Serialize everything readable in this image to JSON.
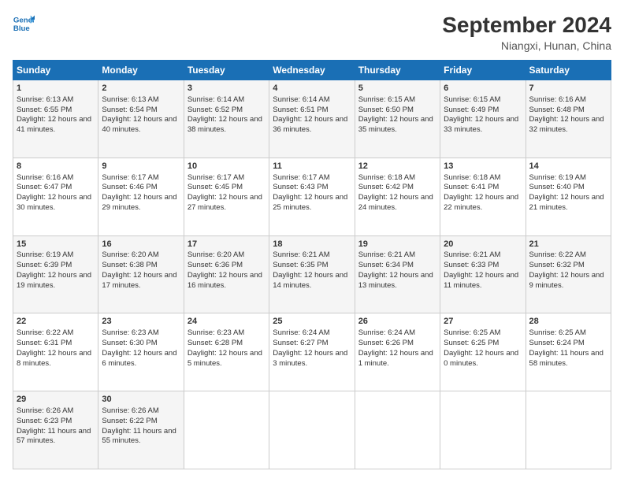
{
  "logo": {
    "line1": "General",
    "line2": "Blue"
  },
  "title": "September 2024",
  "subtitle": "Niangxi, Hunan, China",
  "headers": [
    "Sunday",
    "Monday",
    "Tuesday",
    "Wednesday",
    "Thursday",
    "Friday",
    "Saturday"
  ],
  "weeks": [
    [
      {
        "day": "1",
        "sunrise": "6:13 AM",
        "sunset": "6:55 PM",
        "daylight": "12 hours and 41 minutes."
      },
      {
        "day": "2",
        "sunrise": "6:13 AM",
        "sunset": "6:54 PM",
        "daylight": "12 hours and 40 minutes."
      },
      {
        "day": "3",
        "sunrise": "6:14 AM",
        "sunset": "6:52 PM",
        "daylight": "12 hours and 38 minutes."
      },
      {
        "day": "4",
        "sunrise": "6:14 AM",
        "sunset": "6:51 PM",
        "daylight": "12 hours and 36 minutes."
      },
      {
        "day": "5",
        "sunrise": "6:15 AM",
        "sunset": "6:50 PM",
        "daylight": "12 hours and 35 minutes."
      },
      {
        "day": "6",
        "sunrise": "6:15 AM",
        "sunset": "6:49 PM",
        "daylight": "12 hours and 33 minutes."
      },
      {
        "day": "7",
        "sunrise": "6:16 AM",
        "sunset": "6:48 PM",
        "daylight": "12 hours and 32 minutes."
      }
    ],
    [
      {
        "day": "8",
        "sunrise": "6:16 AM",
        "sunset": "6:47 PM",
        "daylight": "12 hours and 30 minutes."
      },
      {
        "day": "9",
        "sunrise": "6:17 AM",
        "sunset": "6:46 PM",
        "daylight": "12 hours and 29 minutes."
      },
      {
        "day": "10",
        "sunrise": "6:17 AM",
        "sunset": "6:45 PM",
        "daylight": "12 hours and 27 minutes."
      },
      {
        "day": "11",
        "sunrise": "6:17 AM",
        "sunset": "6:43 PM",
        "daylight": "12 hours and 25 minutes."
      },
      {
        "day": "12",
        "sunrise": "6:18 AM",
        "sunset": "6:42 PM",
        "daylight": "12 hours and 24 minutes."
      },
      {
        "day": "13",
        "sunrise": "6:18 AM",
        "sunset": "6:41 PM",
        "daylight": "12 hours and 22 minutes."
      },
      {
        "day": "14",
        "sunrise": "6:19 AM",
        "sunset": "6:40 PM",
        "daylight": "12 hours and 21 minutes."
      }
    ],
    [
      {
        "day": "15",
        "sunrise": "6:19 AM",
        "sunset": "6:39 PM",
        "daylight": "12 hours and 19 minutes."
      },
      {
        "day": "16",
        "sunrise": "6:20 AM",
        "sunset": "6:38 PM",
        "daylight": "12 hours and 17 minutes."
      },
      {
        "day": "17",
        "sunrise": "6:20 AM",
        "sunset": "6:36 PM",
        "daylight": "12 hours and 16 minutes."
      },
      {
        "day": "18",
        "sunrise": "6:21 AM",
        "sunset": "6:35 PM",
        "daylight": "12 hours and 14 minutes."
      },
      {
        "day": "19",
        "sunrise": "6:21 AM",
        "sunset": "6:34 PM",
        "daylight": "12 hours and 13 minutes."
      },
      {
        "day": "20",
        "sunrise": "6:21 AM",
        "sunset": "6:33 PM",
        "daylight": "12 hours and 11 minutes."
      },
      {
        "day": "21",
        "sunrise": "6:22 AM",
        "sunset": "6:32 PM",
        "daylight": "12 hours and 9 minutes."
      }
    ],
    [
      {
        "day": "22",
        "sunrise": "6:22 AM",
        "sunset": "6:31 PM",
        "daylight": "12 hours and 8 minutes."
      },
      {
        "day": "23",
        "sunrise": "6:23 AM",
        "sunset": "6:30 PM",
        "daylight": "12 hours and 6 minutes."
      },
      {
        "day": "24",
        "sunrise": "6:23 AM",
        "sunset": "6:28 PM",
        "daylight": "12 hours and 5 minutes."
      },
      {
        "day": "25",
        "sunrise": "6:24 AM",
        "sunset": "6:27 PM",
        "daylight": "12 hours and 3 minutes."
      },
      {
        "day": "26",
        "sunrise": "6:24 AM",
        "sunset": "6:26 PM",
        "daylight": "12 hours and 1 minute."
      },
      {
        "day": "27",
        "sunrise": "6:25 AM",
        "sunset": "6:25 PM",
        "daylight": "12 hours and 0 minutes."
      },
      {
        "day": "28",
        "sunrise": "6:25 AM",
        "sunset": "6:24 PM",
        "daylight": "11 hours and 58 minutes."
      }
    ],
    [
      {
        "day": "29",
        "sunrise": "6:26 AM",
        "sunset": "6:23 PM",
        "daylight": "11 hours and 57 minutes."
      },
      {
        "day": "30",
        "sunrise": "6:26 AM",
        "sunset": "6:22 PM",
        "daylight": "11 hours and 55 minutes."
      },
      null,
      null,
      null,
      null,
      null
    ]
  ]
}
